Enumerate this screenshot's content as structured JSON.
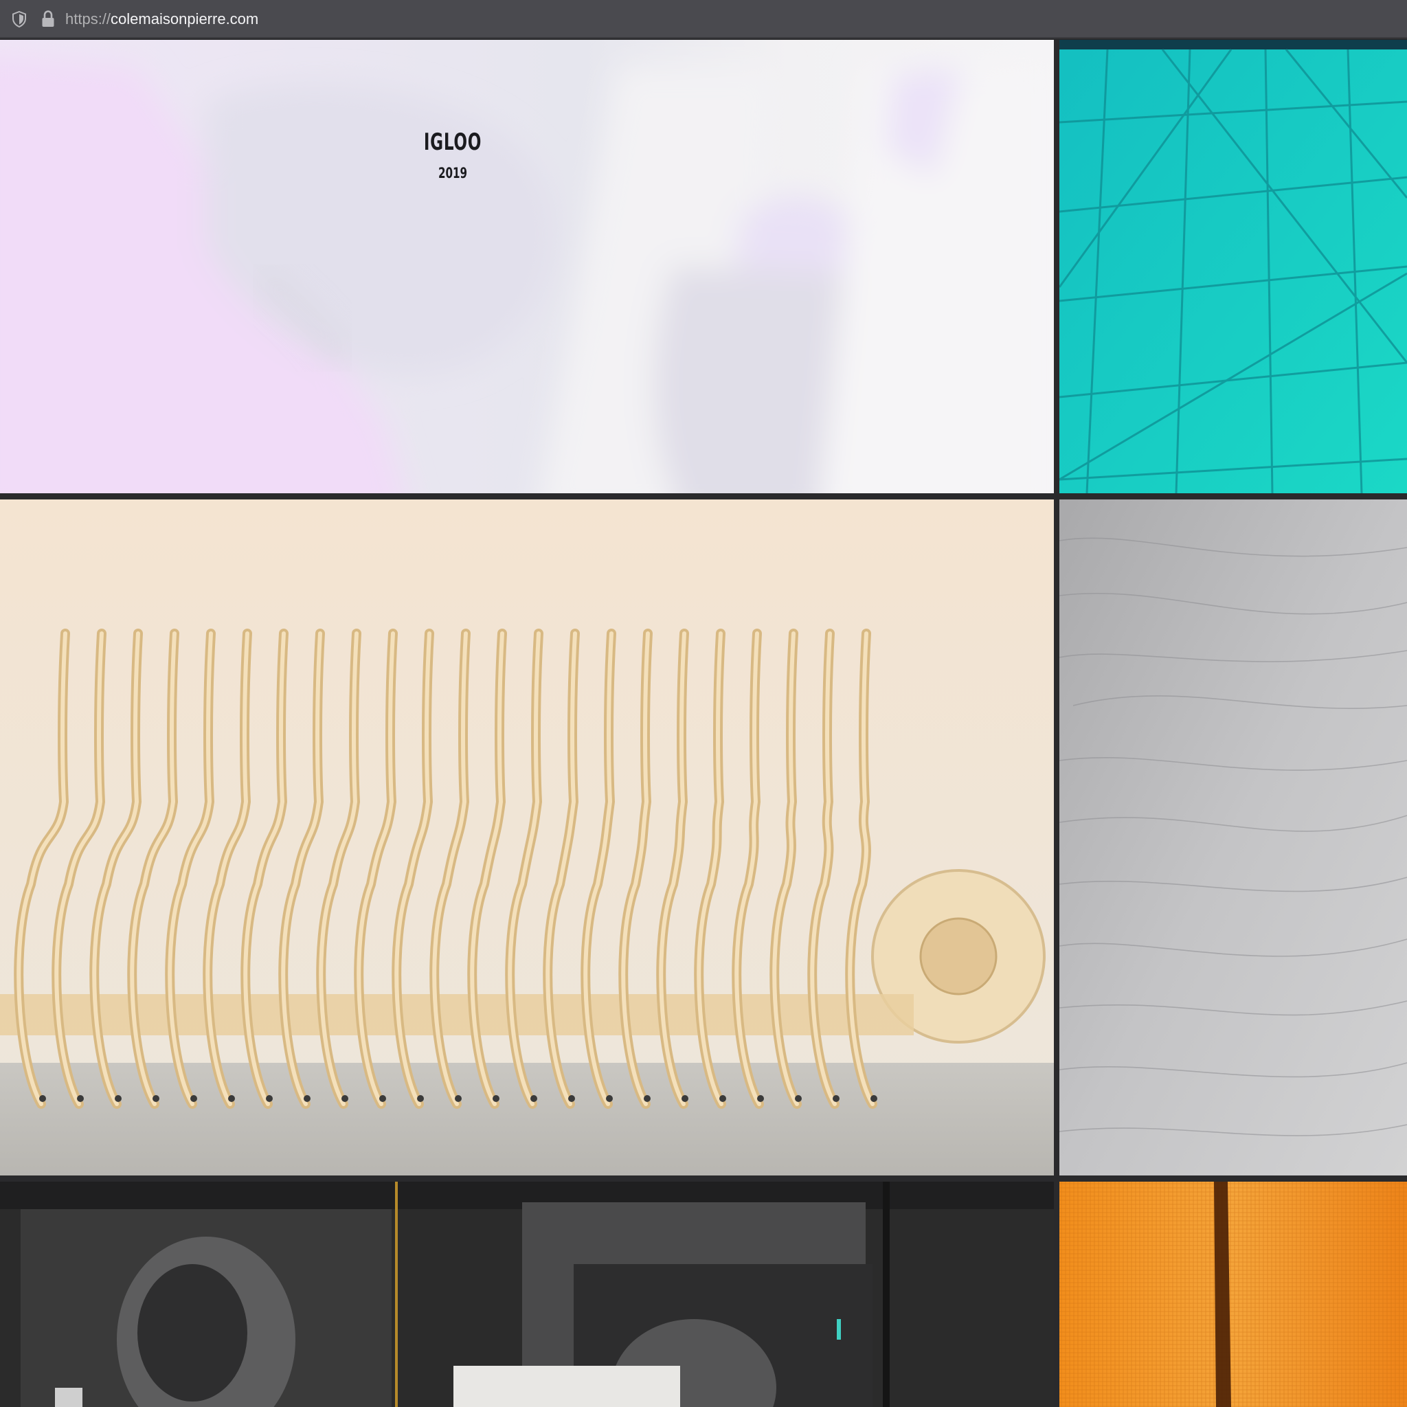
{
  "browser": {
    "url_scheme": "https://",
    "url_host": "colemaisonpierre.com",
    "icons": [
      "shield-icon",
      "lock-icon"
    ]
  },
  "gallery": {
    "featured": {
      "title": "IGLOO",
      "year": "2019"
    },
    "tiles": [
      {
        "name": "igloo-hero",
        "description": "pastel lavender blurred close-up"
      },
      {
        "name": "turquoise-glass",
        "description": "turquoise panel with crossing lines"
      },
      {
        "name": "wooden-bench",
        "description": "ribbed plywood bench"
      },
      {
        "name": "grey-plywood",
        "description": "grey plywood grain texture"
      },
      {
        "name": "studio-projection",
        "description": "dark studio with projected images"
      },
      {
        "name": "orange-fabric",
        "description": "orange woven fabric with dark stripe"
      }
    ]
  },
  "colors": {
    "page_background": "#2a2a2c",
    "urlbar": "#4a4a4f",
    "turquoise": "#1ecfc9",
    "orange": "#f08a1a",
    "plywood": "#e8cf9e"
  }
}
